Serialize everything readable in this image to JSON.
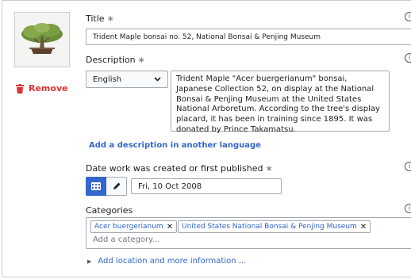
{
  "file": {
    "thumbnail_alt": "Trident Maple bonsai thumbnail",
    "remove_label": "Remove"
  },
  "title": {
    "label": "Title",
    "required_mark": "∗",
    "value": "Trident Maple bonsai no. 52, National Bonsai & Penjing Museum"
  },
  "description": {
    "label": "Description",
    "required_mark": "∗",
    "language": "English",
    "value": "Trident Maple \"Acer buergerianum\" bonsai, Japanese Collection 52, on display at the National Bonsai & Penjing Museum at the United States National Arboretum. According to the tree's display placard, it has been in training since 1895. It was donated by Prince Takamatsu.",
    "add_language_link": "Add a description in another language"
  },
  "date": {
    "label": "Date work was created or first published",
    "required_mark": "∗",
    "value": "Fri, 10 Oct 2008"
  },
  "categories": {
    "label": "Categories",
    "items": [
      "Acer buergerianum",
      "United States National Bonsai & Penjing Museum"
    ],
    "placeholder": "Add a category..."
  },
  "more_info_link": "Add location and more information ...",
  "colors": {
    "accent": "#3366cc",
    "destructive": "#d33",
    "border": "#a2a9b1"
  },
  "icons": {
    "remove": "trash-icon",
    "calendar": "calendar-icon",
    "pencil": "pencil-icon",
    "info": "info-icon",
    "dropdown": "chevron-down-icon",
    "chip_remove": "close-icon",
    "expand": "caret-right-icon"
  }
}
